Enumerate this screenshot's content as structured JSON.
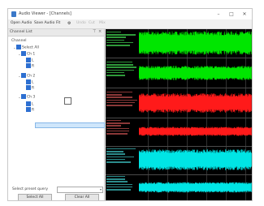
{
  "window": {
    "title": "Audio Viewer - [Channels]",
    "controls": {
      "minimize": "–",
      "maximize": "□",
      "close": "✕"
    }
  },
  "toolbar": {
    "buttons": [
      "Open Audio",
      "Save Audio",
      "Fit"
    ],
    "disabled_buttons": [
      "Undo",
      "Cut",
      "Mix"
    ]
  },
  "left_pane": {
    "header_title": "Channel List",
    "tree": {
      "root": "Channel",
      "group": "Select All",
      "items": [
        "Ch 1",
        "L",
        "R",
        "Ch 2",
        "L",
        "R",
        "Ch 3",
        "L",
        "R"
      ]
    },
    "bottom": {
      "select_label": "Select preset query",
      "combo_value": "",
      "select_all": "Select All",
      "clear_all": "Clear All"
    }
  },
  "waveform": {
    "channels": [
      {
        "color": "#00e600",
        "label_color": "#2f9a3a"
      },
      {
        "color": "#00e600",
        "label_color": "#2f9a3a"
      },
      {
        "color": "#ff1a1a",
        "label_color": "#8b3838"
      },
      {
        "color": "#ff1a1a",
        "label_color": "#8b3838"
      },
      {
        "color": "#00e5e5",
        "label_color": "#2c8c8c"
      },
      {
        "color": "#00e5e5",
        "label_color": "#2c8c8c"
      }
    ]
  }
}
